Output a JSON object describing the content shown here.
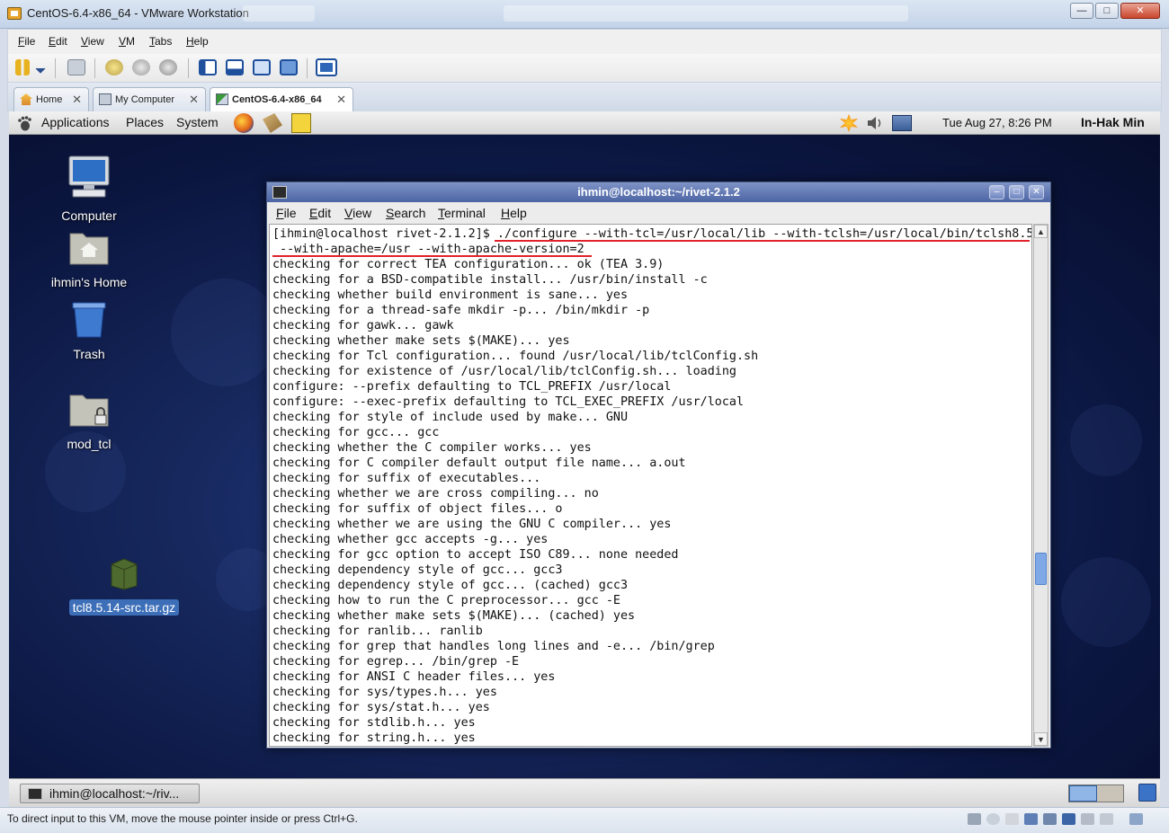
{
  "vmware": {
    "title": "CentOS-6.4-x86_64 - VMware Workstation",
    "menu": [
      "File",
      "Edit",
      "View",
      "VM",
      "Tabs",
      "Help"
    ],
    "tabs": [
      {
        "label": "Home",
        "active": false
      },
      {
        "label": "My Computer",
        "active": false
      },
      {
        "label": "CentOS-6.4-x86_64",
        "active": true
      }
    ],
    "status_text": "To direct input to this VM, move the mouse pointer inside or press Ctrl+G."
  },
  "gnome_panel": {
    "menus": [
      "Applications",
      "Places",
      "System"
    ],
    "clock": "Tue Aug 27,  8:26 PM",
    "user": "In-Hak Min"
  },
  "desktop_icons": {
    "computer": "Computer",
    "home": "ihmin's Home",
    "trash": "Trash",
    "mod_tcl": "mod_tcl",
    "tarball": "tcl8.5.14-src.tar.gz"
  },
  "terminal": {
    "title": "ihmin@localhost:~/rivet-2.1.2",
    "menu": [
      "File",
      "Edit",
      "View",
      "Search",
      "Terminal",
      "Help"
    ],
    "lines": [
      "[ihmin@localhost rivet-2.1.2]$ ./configure --with-tcl=/usr/local/lib --with-tclsh=/usr/local/bin/tclsh8.5",
      " --with-apache=/usr --with-apache-version=2",
      "checking for correct TEA configuration... ok (TEA 3.9)",
      "checking for a BSD-compatible install... /usr/bin/install -c",
      "checking whether build environment is sane... yes",
      "checking for a thread-safe mkdir -p... /bin/mkdir -p",
      "checking for gawk... gawk",
      "checking whether make sets $(MAKE)... yes",
      "checking for Tcl configuration... found /usr/local/lib/tclConfig.sh",
      "checking for existence of /usr/local/lib/tclConfig.sh... loading",
      "configure: --prefix defaulting to TCL_PREFIX /usr/local",
      "configure: --exec-prefix defaulting to TCL_EXEC_PREFIX /usr/local",
      "checking for style of include used by make... GNU",
      "checking for gcc... gcc",
      "checking whether the C compiler works... yes",
      "checking for C compiler default output file name... a.out",
      "checking for suffix of executables...",
      "checking whether we are cross compiling... no",
      "checking for suffix of object files... o",
      "checking whether we are using the GNU C compiler... yes",
      "checking whether gcc accepts -g... yes",
      "checking for gcc option to accept ISO C89... none needed",
      "checking dependency style of gcc... gcc3",
      "checking dependency style of gcc... (cached) gcc3",
      "checking how to run the C preprocessor... gcc -E",
      "checking whether make sets $(MAKE)... (cached) yes",
      "checking for ranlib... ranlib",
      "checking for grep that handles long lines and -e... /bin/grep",
      "checking for egrep... /bin/grep -E",
      "checking for ANSI C header files... yes",
      "checking for sys/types.h... yes",
      "checking for sys/stat.h... yes",
      "checking for stdlib.h... yes",
      "checking for string.h... yes"
    ],
    "scroll_position": 0.68
  },
  "taskbar": {
    "task_label": "ihmin@localhost:~/riv..."
  },
  "colors": {
    "highlight_underline": "#e0222a",
    "selection": "#3d6fb8",
    "titlebar": "#4c64a4"
  }
}
